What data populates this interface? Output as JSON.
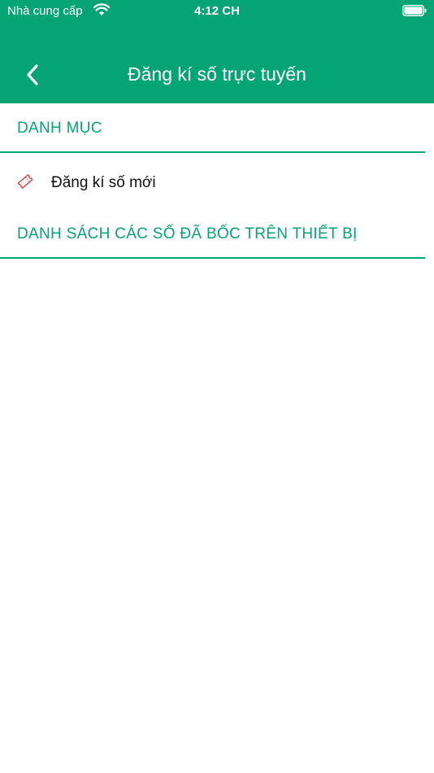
{
  "status_bar": {
    "carrier": "Nhà cung cấp",
    "time": "4:12 CH",
    "wifi_icon": "wifi-icon",
    "battery_icon": "battery-icon"
  },
  "nav": {
    "title": "Đăng kí số trực tuyến",
    "back_icon": "chevron-left-icon"
  },
  "sections": [
    {
      "title": "DANH MỤC"
    },
    {
      "title": "DANH SÁCH CÁC SỐ ĐÃ BỐC TRÊN THIẾT BỊ"
    }
  ],
  "menu_items": [
    {
      "label": "Đăng kí số mới",
      "icon": "ticket-icon"
    }
  ],
  "colors": {
    "primary": "#05a475",
    "icon_accent": "#e0353d",
    "text": "#111111",
    "background": "#ffffff"
  }
}
